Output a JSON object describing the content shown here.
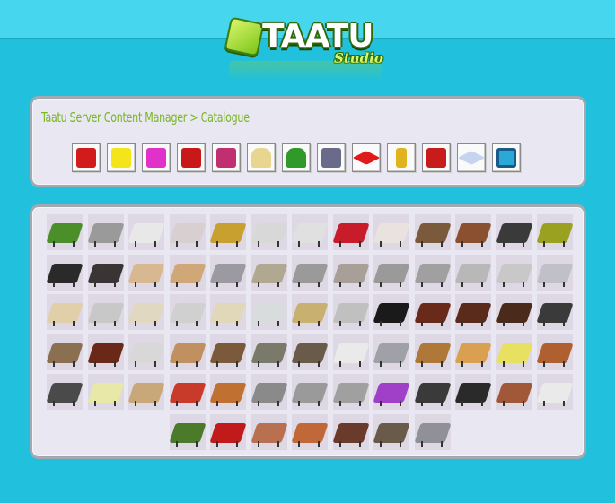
{
  "brand": {
    "logo_text": "TAATU",
    "logo_sub": "Studio"
  },
  "header": {
    "title": "Taatu Server Content Manager > Catalogue"
  },
  "categories": [
    {
      "name": "chairs",
      "icon": "chair-icon",
      "color": "#d21c1c"
    },
    {
      "name": "tables",
      "icon": "table-icon",
      "color": "#f4e41a"
    },
    {
      "name": "sofas",
      "icon": "sofa-icon",
      "color": "#e032c8"
    },
    {
      "name": "cabinets",
      "icon": "cabinet-icon",
      "color": "#c81818"
    },
    {
      "name": "beds",
      "icon": "bed-icon",
      "color": "#c03070"
    },
    {
      "name": "lamps",
      "icon": "lamp-icon",
      "color": "#e8d690"
    },
    {
      "name": "plants",
      "icon": "plant-icon",
      "color": "#2f9a2a"
    },
    {
      "name": "electronics",
      "icon": "computer-icon",
      "color": "#6a6a8a"
    },
    {
      "name": "rugs",
      "icon": "rug-icon",
      "color": "#e01a1a"
    },
    {
      "name": "doors",
      "icon": "door-icon",
      "color": "#e0b41e"
    },
    {
      "name": "walls",
      "icon": "wall-icon",
      "color": "#c81c1c"
    },
    {
      "name": "floors",
      "icon": "floor-icon",
      "color": "#c6d4f0"
    },
    {
      "name": "backgrounds",
      "icon": "picture-icon",
      "color": "#2aa8d6"
    }
  ],
  "items": [
    [
      "#4a8f2a",
      "#9a9a9a",
      "#e8e8e8",
      "#d8d0d0",
      "#c8a030",
      "#d8d8d8",
      "#e0e0e0",
      "#c81c2a",
      "#eae2de",
      "#7a5a3a",
      "#8a5030",
      "#3a3a3a",
      "#9aa020"
    ],
    [
      "#2a2a2a",
      "#3a3434",
      "#d8b890",
      "#d0a878",
      "#9a9aa0",
      "#b0a890",
      "#9a9a9a",
      "#a8a098",
      "#9a9a9a",
      "#a0a0a0",
      "#b8b8b8",
      "#c8c8c8",
      "#c0c0c8"
    ],
    [
      "#e0cfa8",
      "#c8c8c8",
      "#e0d8c0",
      "#d0d0d0",
      "#e0d8b8",
      "#d8dcdc",
      "#c8b070",
      "#c0c0c0",
      "#1a1a1a",
      "#6a2a1a",
      "#5a2a1a",
      "#4a2a1a",
      "#3a3a3a"
    ],
    [
      "#8a7050",
      "#6a2818",
      "#d8d8d8",
      "#c09060",
      "#7a5a3a",
      "#7a7a6a",
      "#6a5a4a",
      "#eaeaea",
      "#a0a0a8",
      "#b07838",
      "#d8a050",
      "#e8e060",
      "#b06030"
    ],
    [
      "#4a4a4a",
      "#e8e8a8",
      "#c8a878",
      "#c83a2a",
      "#c07030",
      "#8a8a8a",
      "#9a9a9a",
      "#a0a0a0",
      "#a040c8",
      "#3a3a3a",
      "#2a2a2a",
      "#a05838",
      "#eaeaea"
    ],
    [
      "#4a7a2a",
      "#c01a1a",
      "#b87050",
      "#c06838",
      "#6a3a2a",
      "#6a5a4a",
      "#909098"
    ]
  ]
}
